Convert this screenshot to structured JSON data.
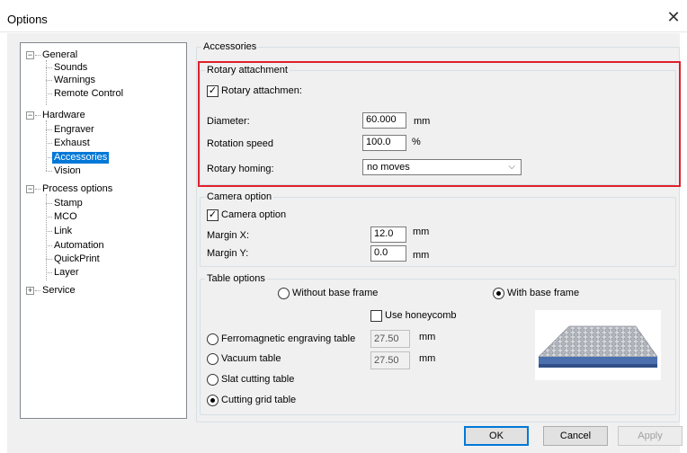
{
  "window": {
    "title": "Options",
    "close_glyph": "✕"
  },
  "tree": {
    "items": [
      {
        "label": "General",
        "expander": "−"
      },
      {
        "label": "Sounds"
      },
      {
        "label": "Warnings"
      },
      {
        "label": "Remote Control"
      },
      {
        "label": "Hardware",
        "expander": "−"
      },
      {
        "label": "Engraver"
      },
      {
        "label": "Exhaust"
      },
      {
        "label": "Accessories",
        "selected": true
      },
      {
        "label": "Vision"
      },
      {
        "label": "Process options",
        "expander": "−"
      },
      {
        "label": "Stamp"
      },
      {
        "label": "MCO"
      },
      {
        "label": "Link"
      },
      {
        "label": "Automation"
      },
      {
        "label": "QuickPrint"
      },
      {
        "label": "Layer"
      },
      {
        "label": "Service",
        "expander": "+"
      }
    ]
  },
  "accessories": {
    "legend": "Accessories",
    "rotary": {
      "legend": "Rotary attachment",
      "checkbox_label": "Rotary attachmen:",
      "checked_glyph": "✓",
      "diameter_label": "Diameter:",
      "diameter_value": "60.000",
      "diameter_unit": "mm",
      "speed_label": "Rotation speed",
      "speed_value": "100.0",
      "speed_unit": "%",
      "homing_label": "Rotary homing:",
      "homing_value": "no moves",
      "homing_arrow": "⌵"
    },
    "camera": {
      "legend": "Camera option",
      "checkbox_label": "Camera option",
      "checked_glyph": "✓",
      "margin_x_label": "Margin X:",
      "margin_x_value": "12.0",
      "margin_x_unit": "mm",
      "margin_y_label": "Margin Y:",
      "margin_y_value": "0.0",
      "margin_y_unit": "mm"
    },
    "table": {
      "legend": "Table options",
      "without_base": "Without base frame",
      "with_base": "With base frame",
      "honeycomb_label": "Use honeycomb",
      "ferro_label": "Ferromagnetic engraving table",
      "ferro_value": "27.50",
      "ferro_unit": "mm",
      "vacuum_label": "Vacuum table",
      "vacuum_value": "27.50",
      "vacuum_unit": "mm",
      "slat_label": "Slat cutting table",
      "grid_label": "Cutting grid table"
    }
  },
  "buttons": {
    "ok": "OK",
    "cancel": "Cancel",
    "apply": "Apply"
  }
}
